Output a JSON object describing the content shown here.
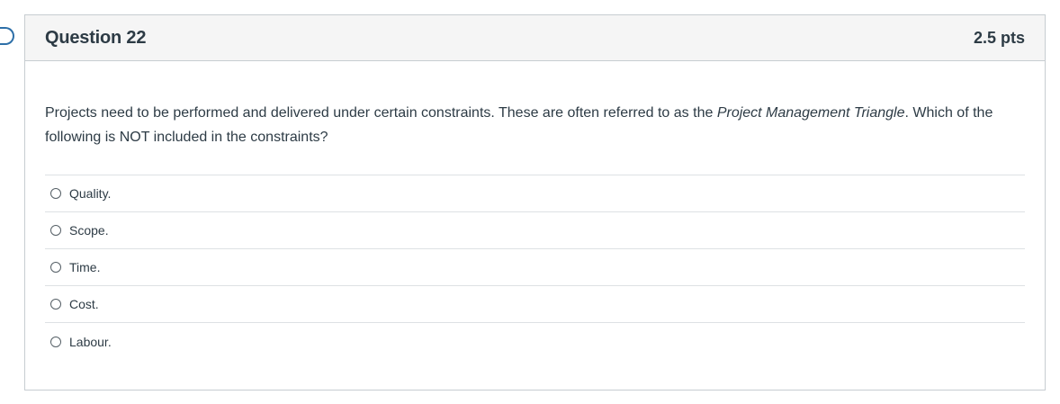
{
  "question": {
    "title": "Question 22",
    "points": "2.5 pts",
    "text_before": "Projects need to be performed and delivered under certain constraints. These are often referred to as the ",
    "text_emphasis": "Project Management Triangle",
    "text_after": ". Which of the following is NOT included in the constraints?",
    "answers": [
      {
        "label": "Quality."
      },
      {
        "label": "Scope."
      },
      {
        "label": "Time."
      },
      {
        "label": "Cost."
      },
      {
        "label": "Labour."
      }
    ]
  },
  "colors": {
    "header_bg": "#f5f5f5",
    "border": "#c7cdd1",
    "text": "#2d3b45",
    "flag_accent": "#2d6fa8"
  }
}
